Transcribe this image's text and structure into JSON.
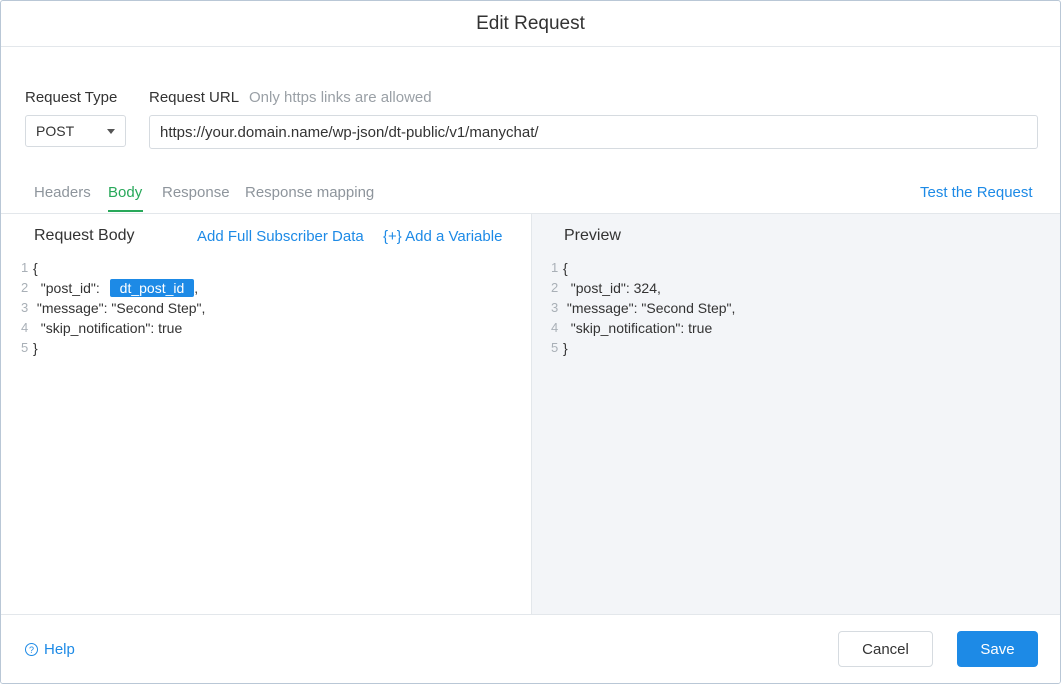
{
  "dialog": {
    "title": "Edit Request"
  },
  "form": {
    "request_type_label": "Request Type",
    "request_url_label": "Request URL",
    "request_url_hint": "Only https links are allowed",
    "request_type_value": "POST",
    "request_url_value": "https://your.domain.name/wp-json/dt-public/v1/manychat/"
  },
  "tabs": [
    {
      "label": "Headers",
      "active": false
    },
    {
      "label": "Body",
      "active": true
    },
    {
      "label": "Response",
      "active": false
    },
    {
      "label": "Response mapping",
      "active": false
    }
  ],
  "test_link": "Test the Request",
  "body": {
    "title": "Request Body",
    "add_full_data": "Add Full Subscriber Data",
    "add_variable": "{+} Add a Variable",
    "lines": [
      {
        "num": "1",
        "text": "{"
      },
      {
        "num": "2",
        "pre": "  \"post_id\": ",
        "var": "dt_post_id",
        "post": ","
      },
      {
        "num": "3",
        "text": " \"message\": \"Second Step\","
      },
      {
        "num": "4",
        "text": "  \"skip_notification\": true"
      },
      {
        "num": "5",
        "text": "}"
      }
    ]
  },
  "preview": {
    "title": "Preview",
    "lines": [
      {
        "num": "1",
        "text": "{"
      },
      {
        "num": "2",
        "text": "  \"post_id\": 324,"
      },
      {
        "num": "3",
        "text": " \"message\": \"Second Step\","
      },
      {
        "num": "4",
        "text": "  \"skip_notification\": true"
      },
      {
        "num": "5",
        "text": "}"
      }
    ]
  },
  "footer": {
    "help": "Help",
    "cancel": "Cancel",
    "save": "Save"
  },
  "colors": {
    "accent": "#1d8ae6",
    "active_tab": "#28a85a",
    "preview_bg": "#f3f5f8"
  }
}
